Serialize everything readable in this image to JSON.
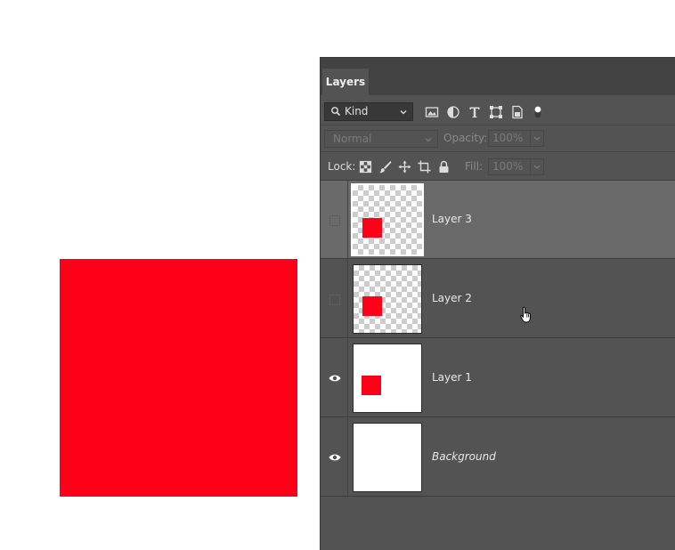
{
  "panel": {
    "tab_label": "Layers",
    "filter": {
      "kind_label": "Kind"
    },
    "blend": {
      "mode": "Normal",
      "opacity_label": "Opacity:",
      "opacity_value": "100%"
    },
    "lock": {
      "label": "Lock:",
      "fill_label": "Fill:",
      "fill_value": "100%"
    },
    "filter_icons": [
      "image-filter-icon",
      "adjustment-filter-icon",
      "type-filter-icon",
      "shape-filter-icon",
      "smart-object-filter-icon",
      "filter-toggle-icon"
    ],
    "lock_icons": [
      "lock-transparent-pixels-icon",
      "lock-image-pixels-icon",
      "lock-position-icon",
      "lock-artboard-icon",
      "lock-all-icon"
    ]
  },
  "layers": [
    {
      "name": "Layer 3",
      "selected": true,
      "visible": false,
      "thumb": "transparent"
    },
    {
      "name": "Layer 2",
      "selected": false,
      "visible": false,
      "thumb": "transparent"
    },
    {
      "name": "Layer 1",
      "selected": false,
      "visible": true,
      "thumb": "white"
    },
    {
      "name": "Background",
      "selected": false,
      "visible": true,
      "thumb": "white",
      "italic": true
    }
  ],
  "colors": {
    "canvas_fill": "#ff0019",
    "panel_bg": "#535353",
    "selected_row": "#6a6a6a"
  }
}
